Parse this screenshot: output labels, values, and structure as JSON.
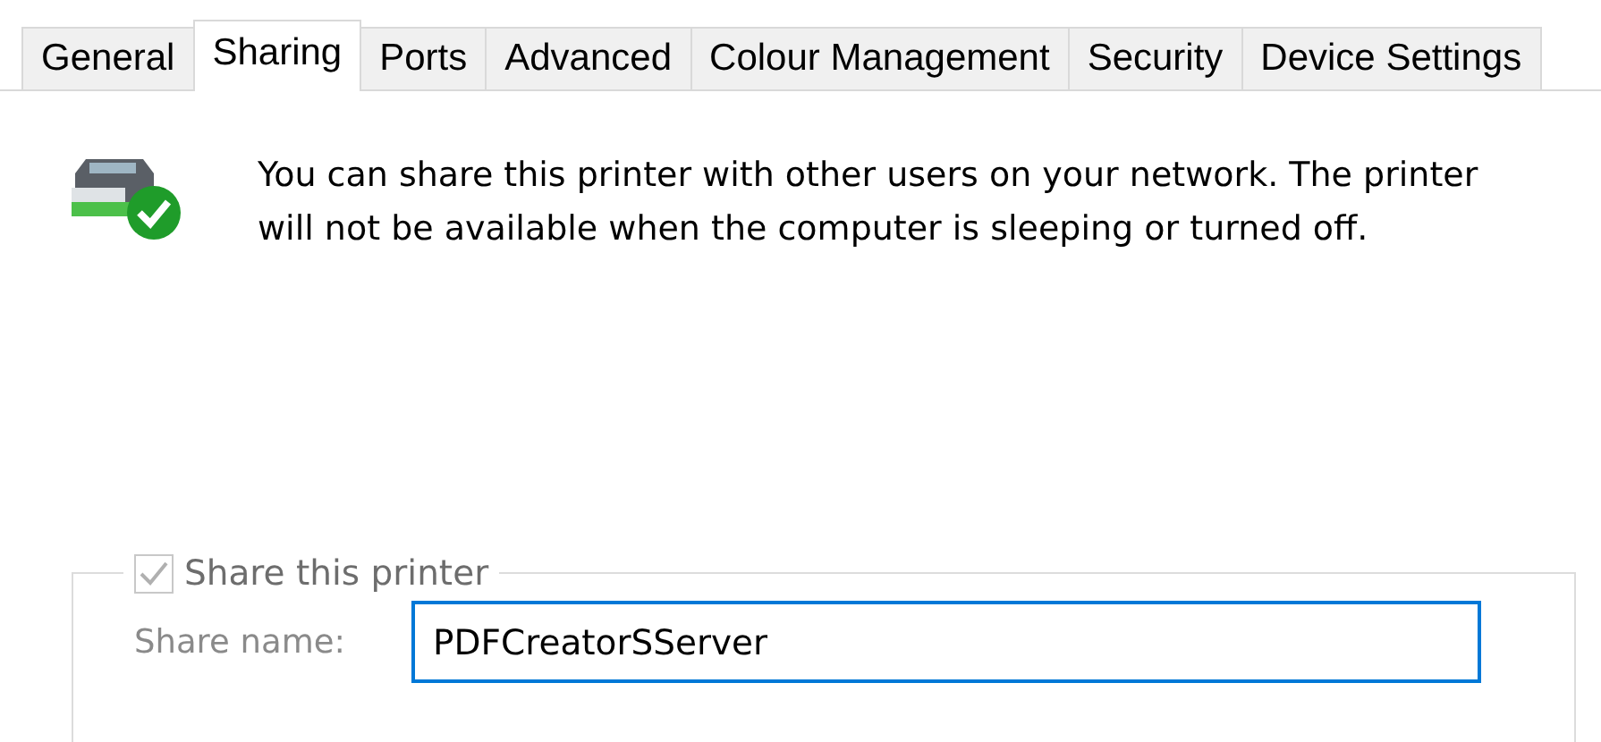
{
  "tabs": [
    {
      "label": "General",
      "selected": false
    },
    {
      "label": "Sharing",
      "selected": true
    },
    {
      "label": "Ports",
      "selected": false
    },
    {
      "label": "Advanced",
      "selected": false
    },
    {
      "label": "Colour Management",
      "selected": false
    },
    {
      "label": "Security",
      "selected": false
    },
    {
      "label": "Device Settings",
      "selected": false
    }
  ],
  "info_text": "You can share this printer with other users on your network. The printer will not be available when the computer is sleeping or turned off.",
  "share_group": {
    "checkbox": {
      "label": "Share this printer",
      "checked": true,
      "disabled": true
    },
    "share_name": {
      "label": "Share name:",
      "value": "PDFCreatorSServer",
      "disabled": true
    }
  }
}
